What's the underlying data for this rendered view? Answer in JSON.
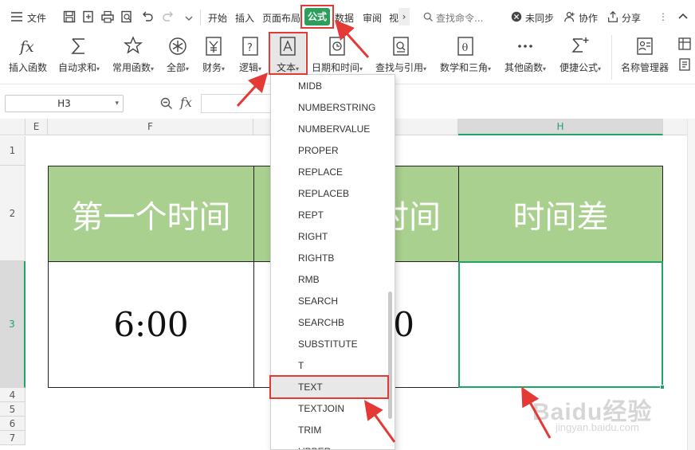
{
  "menubar": {
    "file_label": "文件",
    "tabs": [
      "开始",
      "插入",
      "页面布局",
      "公式",
      "数据",
      "审阅",
      "视"
    ],
    "search_placeholder": "查找命令...",
    "sync_label": "未同步",
    "collab_label": "协作",
    "share_label": "分享"
  },
  "ribbon": {
    "items": [
      {
        "label": "插入函数",
        "icon": "fx-icon"
      },
      {
        "label": "自动求和",
        "icon": "sigma-icon"
      },
      {
        "label": "常用函数",
        "icon": "star-icon"
      },
      {
        "label": "全部",
        "icon": "asterisk-icon"
      },
      {
        "label": "财务",
        "icon": "yen-icon"
      },
      {
        "label": "逻辑",
        "icon": "question-icon"
      },
      {
        "label": "文本",
        "icon": "text-a-icon"
      },
      {
        "label": "日期和时间",
        "icon": "clock-icon"
      },
      {
        "label": "查找与引用",
        "icon": "magnifier-icon"
      },
      {
        "label": "数学和三角",
        "icon": "theta-icon"
      },
      {
        "label": "其他函数",
        "icon": "dots-icon"
      },
      {
        "label": "便捷公式",
        "icon": "sigma-plus-icon"
      },
      {
        "label": "名称管理器",
        "icon": "name-manager-icon"
      }
    ]
  },
  "formula_bar": {
    "name_box": "H3",
    "fx_label": "fx"
  },
  "grid": {
    "columns": [
      "E",
      "F",
      "H"
    ],
    "rows": [
      "1",
      "2",
      "3",
      "4",
      "5",
      "6",
      "7"
    ],
    "header_row": [
      "第一个时间",
      "时间",
      "时间差"
    ],
    "data_row": [
      "6:00",
      "0",
      ""
    ]
  },
  "dropdown": {
    "items": [
      "MIDB",
      "NUMBERSTRING",
      "NUMBERVALUE",
      "PROPER",
      "REPLACE",
      "REPLACEB",
      "REPT",
      "RIGHT",
      "RIGHTB",
      "RMB",
      "SEARCH",
      "SEARCHB",
      "SUBSTITUTE",
      "T",
      "TEXT",
      "TEXTJOIN",
      "TRIM",
      "UPPER"
    ],
    "selected": "TEXT"
  },
  "colors": {
    "header_green": "#a9d08e",
    "active_tab_green": "#2e9e5b",
    "annotation_red": "#e53935",
    "selection_green": "#21a366"
  },
  "watermark": {
    "brand": "Baidu经验",
    "url": "jingyan.baidu.com"
  }
}
